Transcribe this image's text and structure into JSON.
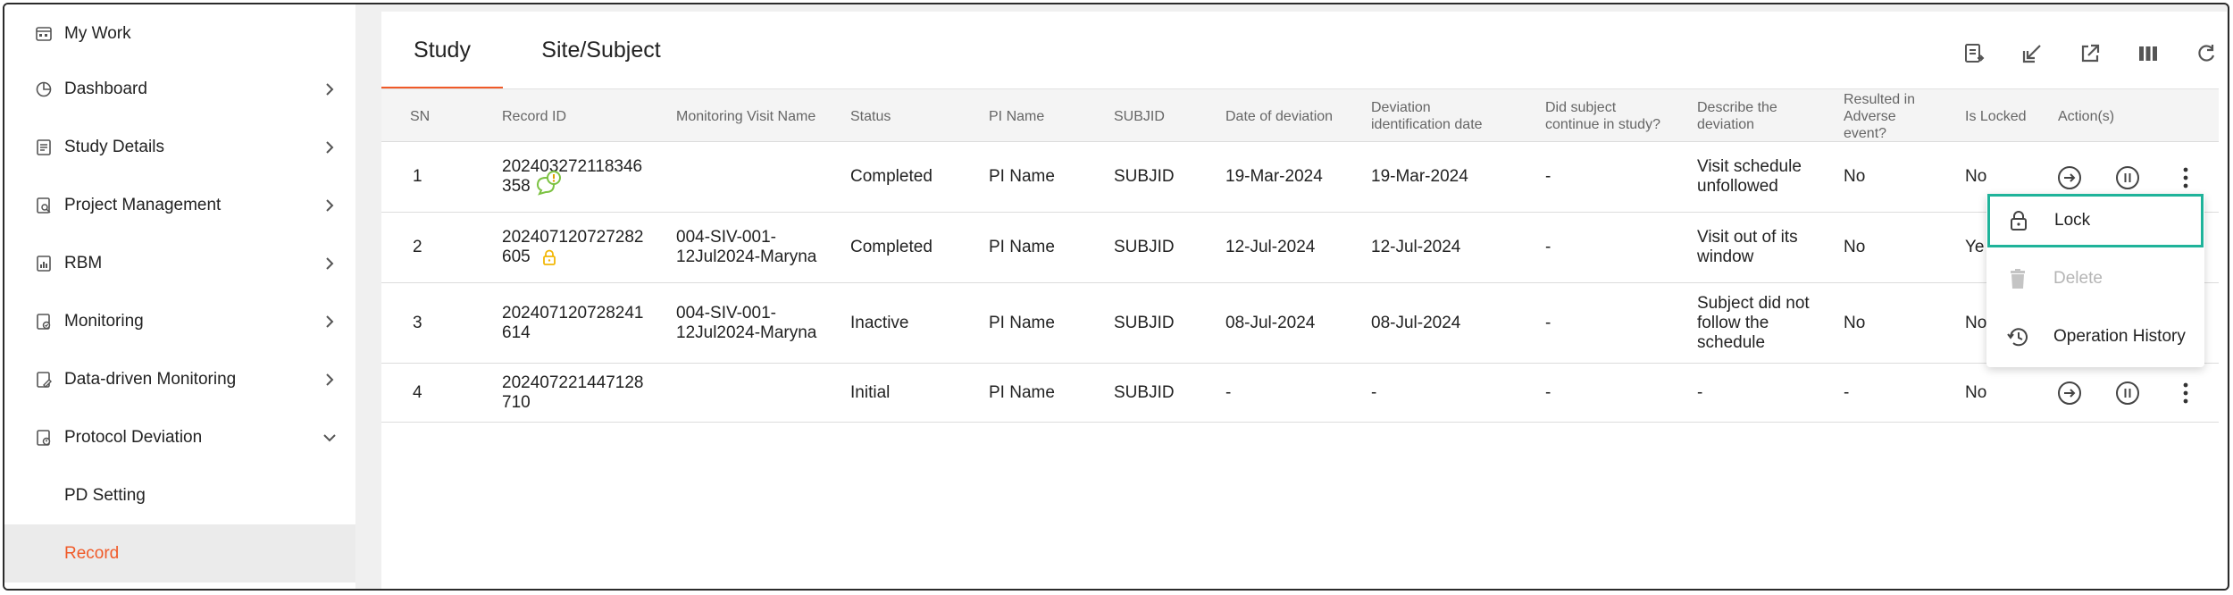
{
  "sidebar": {
    "items": [
      {
        "label": "My Work",
        "icon": "calendar-icon",
        "expandable": false
      },
      {
        "label": "Dashboard",
        "icon": "pie-chart-icon",
        "expandable": true,
        "state": "collapsed"
      },
      {
        "label": "Study Details",
        "icon": "document-list-icon",
        "expandable": true,
        "state": "collapsed"
      },
      {
        "label": "Project Management",
        "icon": "document-search-icon",
        "expandable": true,
        "state": "collapsed"
      },
      {
        "label": "RBM",
        "icon": "document-chart-icon",
        "expandable": true,
        "state": "collapsed"
      },
      {
        "label": "Monitoring",
        "icon": "document-check-icon",
        "expandable": true,
        "state": "collapsed"
      },
      {
        "label": "Data-driven Monitoring",
        "icon": "document-edit-icon",
        "expandable": true,
        "state": "collapsed"
      },
      {
        "label": "Protocol Deviation",
        "icon": "document-alert-icon",
        "expandable": true,
        "state": "expanded"
      }
    ],
    "subitems": [
      {
        "label": "PD Setting"
      },
      {
        "label": "Record",
        "active": true
      }
    ]
  },
  "tabs": [
    {
      "label": "Study",
      "active": true
    },
    {
      "label": "Site/Subject",
      "active": false
    }
  ],
  "toolbar": {
    "buttons": [
      "export-document-icon",
      "import-icon",
      "open-external-icon",
      "columns-icon",
      "refresh-icon",
      "filter-icon",
      "add-icon"
    ]
  },
  "table": {
    "headers": {
      "sn": "SN",
      "record_id": "Record ID",
      "monitoring_visit": "Monitoring Visit Name",
      "status": "Status",
      "pi_name": "PI Name",
      "subjid": "SUBJID",
      "date_deviation": "Date of deviation",
      "deviation_id_date": "Deviation identification date",
      "continue_study": "Did subject continue in study?",
      "describe": "Describe the deviation",
      "adverse": "Resulted in Adverse event?",
      "locked": "Is Locked",
      "actions": "Action(s)"
    },
    "rows": [
      {
        "sn": "1",
        "record_id_line1": "202403272118346",
        "record_id_line2": "358",
        "badge_icon": "comment-alert-icon",
        "monitoring_visit_line1": "",
        "monitoring_visit_line2": "",
        "status": "Completed",
        "pi_name": "PI Name",
        "subjid": "SUBJID",
        "date_deviation": "19-Mar-2024",
        "deviation_id_date": "19-Mar-2024",
        "continue_study": "-",
        "describe_lines": [
          "Visit schedule",
          "unfollowed"
        ],
        "adverse": "No",
        "locked": "No"
      },
      {
        "sn": "2",
        "record_id_line1": "202407120727282",
        "record_id_line2": "605",
        "badge_icon": "lock-icon",
        "monitoring_visit_line1": "004-SIV-001-",
        "monitoring_visit_line2": "12Jul2024-Maryna",
        "status": "Completed",
        "pi_name": "PI Name",
        "subjid": "SUBJID",
        "date_deviation": "12-Jul-2024",
        "deviation_id_date": "12-Jul-2024",
        "continue_study": "-",
        "describe_lines": [
          "Visit out of its",
          "window"
        ],
        "adverse": "No",
        "locked": "Ye"
      },
      {
        "sn": "3",
        "record_id_line1": "202407120728241",
        "record_id_line2": "614",
        "badge_icon": "",
        "monitoring_visit_line1": "004-SIV-001-",
        "monitoring_visit_line2": "12Jul2024-Maryna",
        "status": "Inactive",
        "pi_name": "PI Name",
        "subjid": "SUBJID",
        "date_deviation": "08-Jul-2024",
        "deviation_id_date": "08-Jul-2024",
        "continue_study": "-",
        "describe_lines": [
          "Subject did not",
          "follow the",
          "schedule"
        ],
        "adverse": "No",
        "locked": "No"
      },
      {
        "sn": "4",
        "record_id_line1": "202407221447128",
        "record_id_line2": "710",
        "badge_icon": "",
        "monitoring_visit_line1": "",
        "monitoring_visit_line2": "",
        "status": "Initial",
        "pi_name": "PI Name",
        "subjid": "SUBJID",
        "date_deviation": "-",
        "deviation_id_date": "-",
        "continue_study": "-",
        "describe_lines": [
          "-"
        ],
        "adverse": "-",
        "locked": "No"
      }
    ]
  },
  "context_menu": {
    "items": [
      {
        "label": "Lock",
        "icon": "lock-icon",
        "focused": true
      },
      {
        "label": "Delete",
        "icon": "trash-icon",
        "disabled": true
      },
      {
        "label": "Operation History",
        "icon": "history-icon"
      }
    ]
  },
  "colors": {
    "accent": "#f05a28",
    "focus_ring": "#1fb39a",
    "lock_badge": "#f2b705",
    "comment_badge": "#7cc242"
  }
}
